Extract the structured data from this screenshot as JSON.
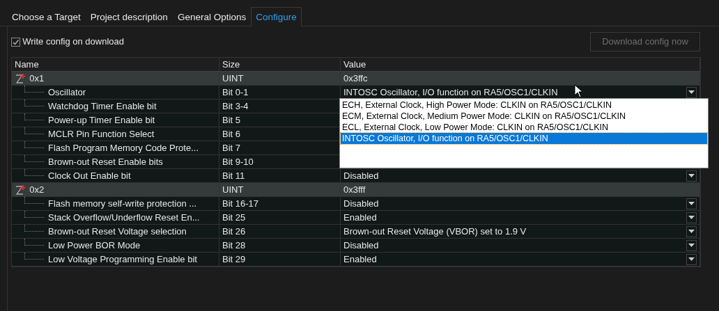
{
  "tabs": [
    {
      "label": "Choose a Target",
      "selected": false
    },
    {
      "label": "Project description",
      "selected": false
    },
    {
      "label": "General Options",
      "selected": false
    },
    {
      "label": "Configure",
      "selected": true
    }
  ],
  "write_config": {
    "label": "Write config on download",
    "checked": true
  },
  "download_button": {
    "label": "Download config now",
    "disabled": true
  },
  "table": {
    "columns": [
      "Name",
      "Size",
      "Value"
    ],
    "groups": [
      {
        "name": "0x1",
        "size": "UINT",
        "value": "0x3ffc",
        "children": [
          {
            "name": "Oscillator",
            "size": "Bit 0-1",
            "value": "INTOSC Oscillator, I/O function on RA5/OSC1/CLKIN",
            "expanded": true,
            "options": [
              {
                "label": "ECH, External Clock, High Power Mode: CLKIN on RA5/OSC1/CLKIN",
                "selected": false
              },
              {
                "label": "ECM, External Clock, Medium Power Mode: CLKIN on RA5/OSC1/CLKIN",
                "selected": false
              },
              {
                "label": "ECL, External Clock, Low Power Mode: CLKIN on RA5/OSC1/CLKIN",
                "selected": false
              },
              {
                "label": "INTOSC Oscillator, I/O function on RA5/OSC1/CLKIN",
                "selected": true
              }
            ]
          },
          {
            "name": "Watchdog Timer Enable bit",
            "size": "Bit 3-4"
          },
          {
            "name": "Power-up Timer Enable bit",
            "size": "Bit 5"
          },
          {
            "name": "MCLR Pin Function Select",
            "size": "Bit 6"
          },
          {
            "name": "Flash Program Memory Code Prote...",
            "size": "Bit 7"
          },
          {
            "name": "Brown-out Reset Enable bits",
            "size": "Bit 9-10"
          },
          {
            "name": "Clock Out Enable bit",
            "size": "Bit 11",
            "value": "Disabled"
          }
        ]
      },
      {
        "name": "0x2",
        "size": "UINT",
        "value": "0x3fff",
        "children": [
          {
            "name": "Flash memory self-write protection ...",
            "size": "Bit 16-17",
            "value": "Disabled"
          },
          {
            "name": "Stack Overflow/Underflow Reset En...",
            "size": "Bit 25",
            "value": "Enabled"
          },
          {
            "name": "Brown-out Reset Voltage selection",
            "size": "Bit 26",
            "value": "Brown-out Reset Voltage (VBOR) set to 1.9 V"
          },
          {
            "name": "Low Power BOR Mode",
            "size": "Bit 28",
            "value": "Disabled"
          },
          {
            "name": "Low Voltage Programming Enable bit",
            "size": "Bit 29",
            "value": "Enabled"
          }
        ]
      }
    ]
  }
}
